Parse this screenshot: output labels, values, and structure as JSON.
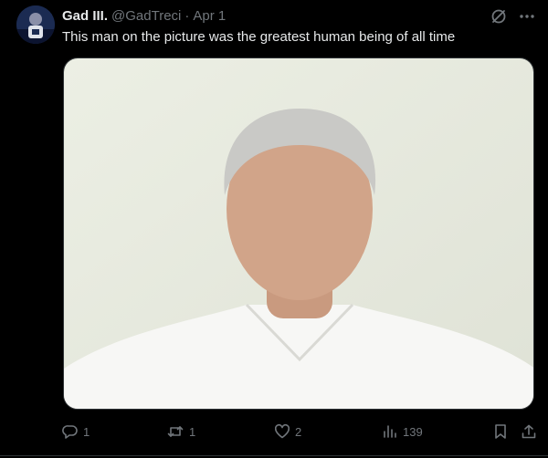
{
  "author": {
    "display_name": "Gad III.",
    "handle": "@GadTreci",
    "separator": "·",
    "date": "Apr 1"
  },
  "tweet": {
    "text": "This man on the picture was the greatest human being of all time"
  },
  "media": {
    "description": "Photo of a man with gray hair in a white collared shirt against a light background"
  },
  "actions": {
    "replies": "1",
    "reposts": "1",
    "likes": "2",
    "views": "139"
  },
  "icons": {
    "top": [
      "grok-icon",
      "more-icon"
    ],
    "bottom": [
      "reply-icon",
      "repost-icon",
      "like-icon",
      "views-icon",
      "bookmark-icon",
      "share-icon"
    ]
  },
  "colors": {
    "background": "#000000",
    "text": "#e7e9ea",
    "muted": "#71767b",
    "border": "#2f3336"
  }
}
